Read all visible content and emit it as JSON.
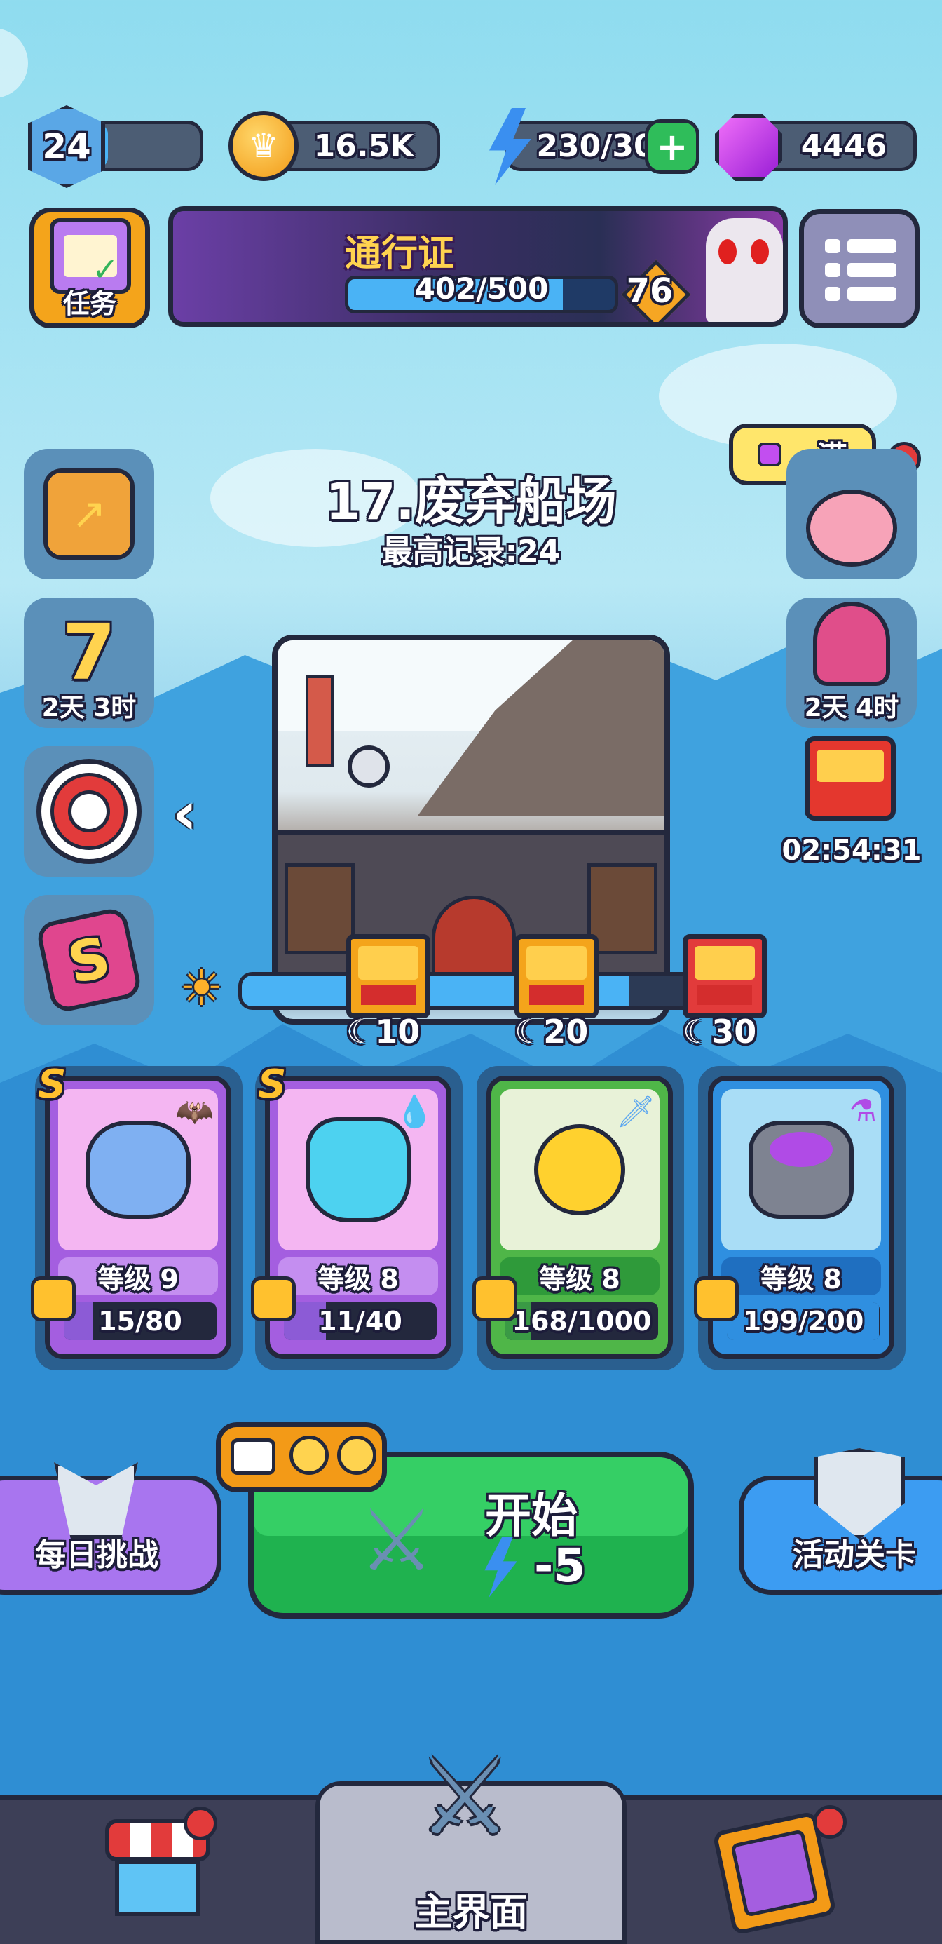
{
  "top_bar": {
    "player_level": "24",
    "level_progress": 0.18,
    "coins": "16.5K",
    "energy": "230/30",
    "gems": "4446"
  },
  "quests": {
    "label": "任务"
  },
  "pass": {
    "title": "通行证",
    "progress_text": "402/500",
    "progress": 0.804,
    "level": "76"
  },
  "stage": {
    "name": "17.废弃船场",
    "best_record": "最高记录:24",
    "day_night_progress": 0.85,
    "milestones": [
      "10",
      "20",
      "30"
    ]
  },
  "left_tiles": {
    "offer_timer": "2天 3时",
    "offer_number": "7"
  },
  "right_tiles": {
    "piggy_bank_label": "满",
    "hero_offer_timer": "2天 4时",
    "chest_timer": "02:54:31"
  },
  "heroes": [
    {
      "rarity": "S",
      "level_label": "等级 9",
      "shards": "15/80",
      "shards_progress": 0.1875,
      "type_icon": "bat-icon",
      "color": "#a45ee0"
    },
    {
      "rarity": "S",
      "level_label": "等级 8",
      "shards": "11/40",
      "shards_progress": 0.275,
      "type_icon": "water-drop-icon",
      "color": "#a45ee0"
    },
    {
      "rarity": "",
      "level_label": "等级 8",
      "shards": "168/1000",
      "shards_progress": 0.168,
      "type_icon": "sword-icon",
      "color": "#4fb648"
    },
    {
      "rarity": "",
      "level_label": "等级 8",
      "shards": "199/200",
      "shards_progress": 0.995,
      "type_icon": "potion-icon",
      "color": "#2f8fe0"
    }
  ],
  "actions": {
    "daily_challenge": "每日挑战",
    "start": "开始",
    "start_cost": "-5",
    "event_stage": "活动关卡"
  },
  "nav": {
    "home_label": "主界面"
  },
  "colors": {
    "accent_green": "#1fb24f",
    "pass_bar": "#4ab3f5",
    "outline": "#23283d"
  }
}
